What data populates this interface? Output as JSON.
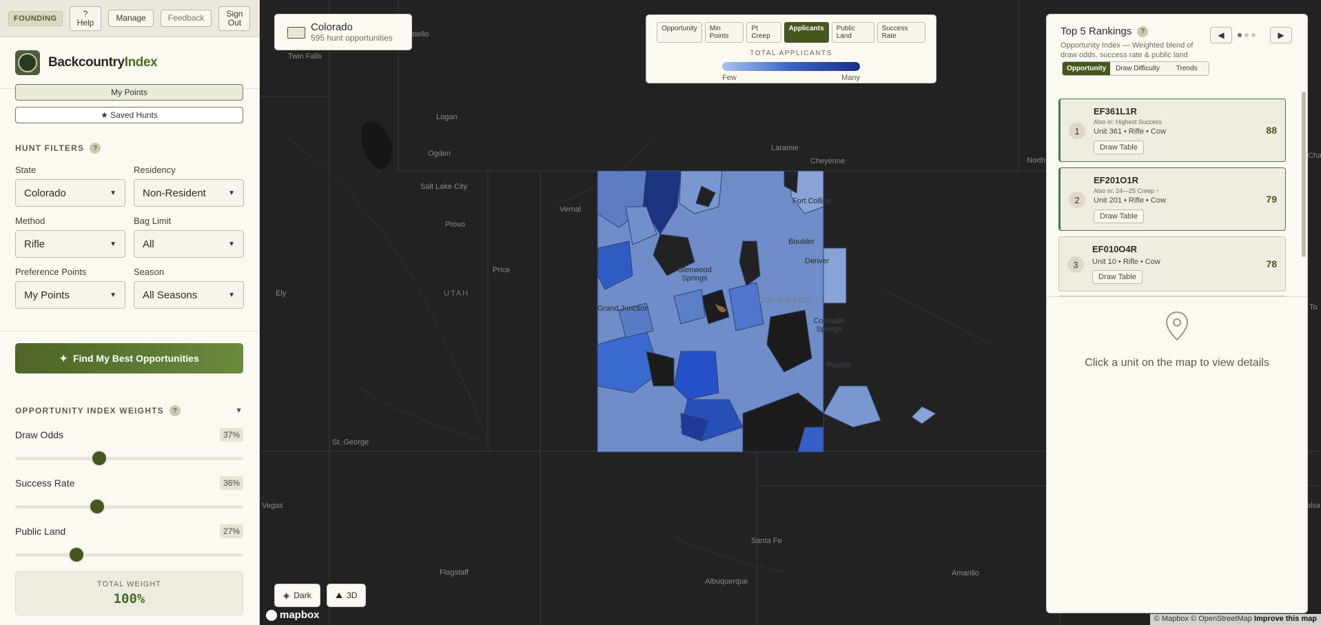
{
  "topbar": {
    "founding": "FOUNDING",
    "help_q": "?",
    "help": "Help",
    "manage": "Manage",
    "feedback": "Feedback",
    "sign": "Sign",
    "out": "Out"
  },
  "brand": {
    "name_a": "Backcountry",
    "name_b": "Index"
  },
  "buttons": {
    "my_points": "My Points",
    "saved_hunts": "★ Saved Hunts",
    "find": "Find My Best Opportunities"
  },
  "filters": {
    "title": "HUNT FILTERS",
    "help": "?",
    "items": [
      {
        "label": "State",
        "value": "Colorado"
      },
      {
        "label": "Residency",
        "value": "Non-Resident"
      },
      {
        "label": "Method",
        "value": "Rifle"
      },
      {
        "label": "Bag Limit",
        "value": "All"
      },
      {
        "label": "Preference Points",
        "value": "My Points"
      },
      {
        "label": "Season",
        "value": "All Seasons"
      }
    ]
  },
  "weights": {
    "title": "OPPORTUNITY INDEX WEIGHTS",
    "help": "?",
    "toggle": "▼",
    "items": [
      {
        "label": "Draw Odds",
        "value": "37%",
        "level": 0.37
      },
      {
        "label": "Success Rate",
        "value": "36%",
        "level": 0.36
      },
      {
        "label": "Public Land",
        "value": "27%",
        "level": 0.27
      }
    ],
    "total_label": "TOTAL WEIGHT",
    "total_value": "100%"
  },
  "map": {
    "state_name": "Colorado",
    "state_count": "595 hunt opportunities",
    "tabs": [
      "Opportunity",
      "Min Points",
      "Pt Creep",
      "Applicants",
      "Public Land",
      "Success Rate"
    ],
    "active_tab": "Applicants",
    "legend_title": "TOTAL APPLICANTS",
    "legend_low": "Few",
    "legend_high": "Many",
    "dark_btn": "Dark",
    "btn_3d": "3D",
    "mapbox": "mapbox",
    "attribution": "© Mapbox © OpenStreetMap",
    "improve": "Improve this map",
    "labels": {
      "pocatello": "atello",
      "twin_falls": "Twin Falls",
      "logan": "Logan",
      "ogden": "Ogden",
      "salt_lake": "Salt Lake City",
      "provo": "Provo",
      "vernal": "Vernal",
      "price": "Price",
      "utah": "UTAH",
      "ely": "Ely",
      "st_george": "St. George",
      "vegas": "Vegas",
      "flagstaff": "Flagstaff",
      "albuquerque": "Albuquerque",
      "santa_fe": "Santa Fe",
      "amarillo": "Amarillo",
      "laramie": "Laramie",
      "cheyenne": "Cheyenne",
      "fort_collins": "Fort Collins",
      "boulder": "Boulder",
      "denver": "Denver",
      "glenwood": "Glenwood Springs",
      "colorado": "COLORADO",
      "grand_junction": "Grand Junction",
      "colorado_springs": "Colorado Springs",
      "pueblo": "Pueblo",
      "north": "North",
      "to": "To",
      "cha": "Cha",
      "alsa": "alsa"
    }
  },
  "rankings": {
    "title": "Top 5 Rankings",
    "help": "?",
    "subtitle": "Opportunity Index — Weighted blend of draw odds, success rate & public land",
    "prev": "◀",
    "next": "▶",
    "segments": [
      "Opportunity",
      "Draw Difficulty",
      "Trends"
    ],
    "active_segment": "Opportunity",
    "items": [
      {
        "rank": "1",
        "code": "EF361L1R",
        "also": "Also in: Highest Success",
        "unit": "Unit 361 • Rifle • Cow",
        "draw": "Draw Table",
        "score": "88"
      },
      {
        "rank": "2",
        "code": "EF201O1R",
        "also": "Also in: 24—25 Creep ↑",
        "unit": "Unit 201 • Rifle • Cow",
        "draw": "Draw Table",
        "score": "79"
      },
      {
        "rank": "3",
        "code": "EF010O4R",
        "also": "",
        "unit": "Unit 10 • Rifle • Cow",
        "draw": "Draw Table",
        "score": "78"
      }
    ],
    "empty_detail": "Click a unit on the map to view details"
  }
}
